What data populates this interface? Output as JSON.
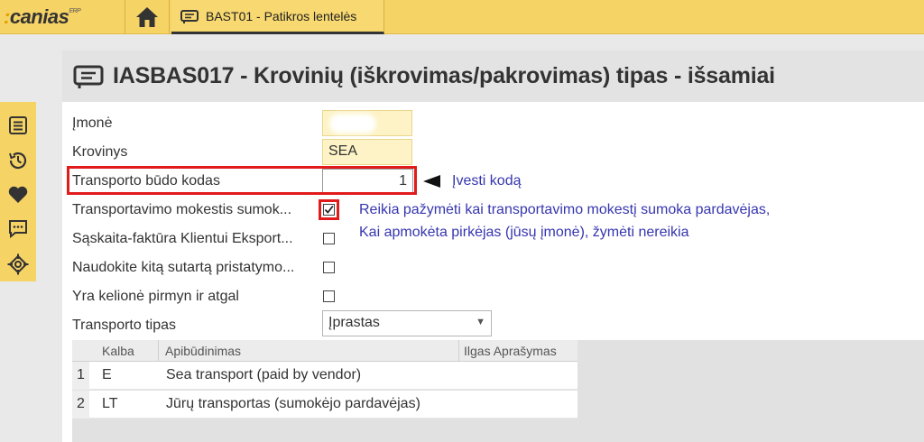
{
  "app": {
    "logo_text": "canias",
    "logo_sup": "ERP"
  },
  "tab": {
    "label": "BAST01 - Patikros lentelės"
  },
  "page": {
    "title": "IASBAS017 - Krovinių (iškrovimas/pakrovimas) tipas - išsamiai"
  },
  "form": {
    "company_label": "Įmonė",
    "cargo_label": "Krovinys",
    "cargo_value": "SEA",
    "transport_code_label": "Transporto būdo kodas",
    "transport_code_value": "1",
    "fee_label": "Transportavimo mokestis sumok...",
    "fee_checked": true,
    "invoice_label": "Sąskaita-faktūra Klientui Eksport...",
    "invoice_checked": false,
    "contract_label": "Naudokite kitą sutartą pristatymo...",
    "contract_checked": false,
    "roundtrip_label": "Yra kelionė pirmyn ir atgal",
    "roundtrip_checked": false,
    "transport_type_label": "Transporto tipas",
    "transport_type_value": "Įprastas"
  },
  "annotations": {
    "enter_code": "Įvesti kodą",
    "note_line1": "Reikia pažymėti kai transportavimo mokestį sumoka pardavėjas,",
    "note_line2": "Kai apmokėta pirkėjas (jūsų įmonė), žymėti nereikia"
  },
  "grid": {
    "headers": {
      "language": "Kalba",
      "description": "Apibūdinimas",
      "long_description": "Ilgas Aprašymas"
    },
    "rows": [
      {
        "num": "1",
        "language": "E",
        "description": "Sea transport (paid by vendor)"
      },
      {
        "num": "2",
        "language": "LT",
        "description": "Jūrų transportas (sumokėjo pardavėjas)"
      }
    ]
  },
  "icons": {
    "home": "home-icon",
    "tab": "table-icon",
    "sidebar": [
      "list-icon",
      "history-icon",
      "heart-icon",
      "chat-icon",
      "target-icon"
    ]
  },
  "colors": {
    "brand_yellow": "#f6d365",
    "highlight_red": "#e11b1b",
    "annotation_blue": "#3636b0"
  }
}
